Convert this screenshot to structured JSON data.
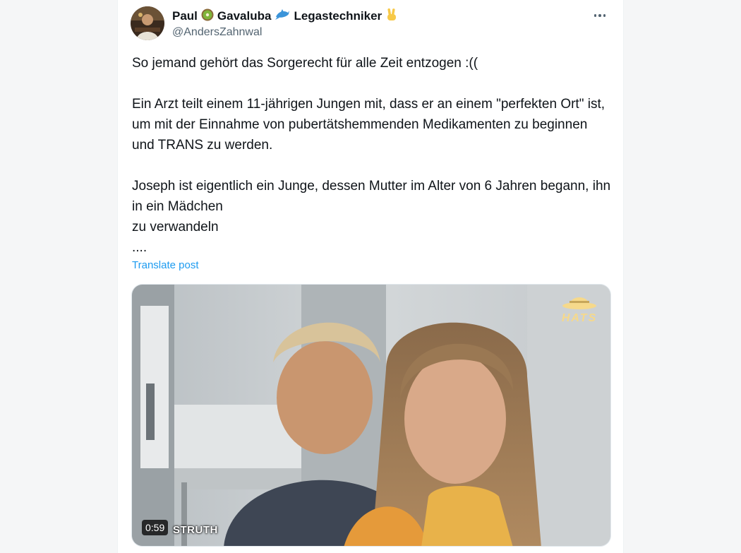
{
  "tweet": {
    "author": {
      "name_part1": "Paul",
      "name_part2": "Gavaluba",
      "name_part3": "Legastechniker",
      "handle": "@AndersZahnwal",
      "name_emojis": [
        "kiwi-icon",
        "dolphin-icon",
        "victory-hand-icon"
      ]
    },
    "text": {
      "line1": "So jemand gehört das Sorgerecht für alle Zeit entzogen :((",
      "paragraph2": "Ein Arzt teilt einem 11-jährigen Jungen mit, dass er an einem \"perfekten Ort\" ist, um mit der Einnahme von pubertätshemmenden Medikamenten zu beginnen und TRANS zu werden.",
      "paragraph3_a": "Joseph ist eigentlich ein Junge, dessen Mutter im Alter von 6 Jahren begann, ihn in ein Mädchen",
      "paragraph3_b": "zu verwandeln",
      "ellipsis": "...."
    },
    "translate_label": "Translate post",
    "media": {
      "duration": "0:59",
      "watermark_text": "STRUTH",
      "logo_text": "HATS"
    }
  },
  "colors": {
    "link": "#1d9bf0",
    "text_primary": "#0f1419",
    "text_secondary": "#536471"
  }
}
